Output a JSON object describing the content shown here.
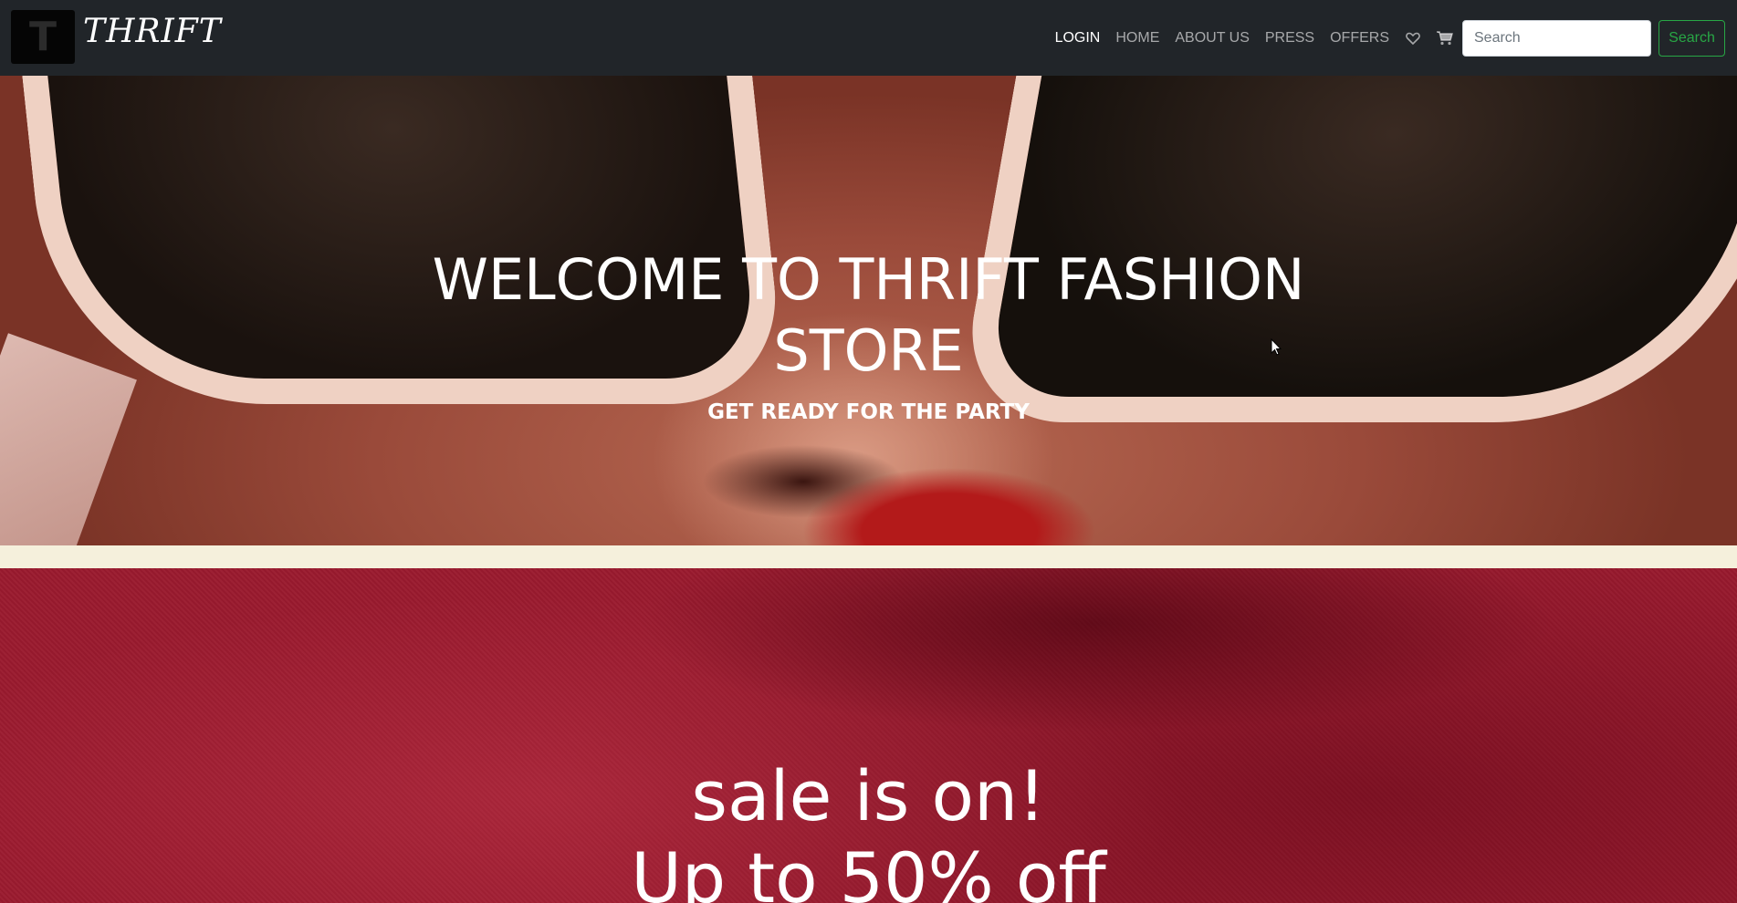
{
  "navbar": {
    "logo_letter": "T",
    "brand": "THRIFT",
    "links": [
      {
        "label": "LOGIN"
      },
      {
        "label": "HOME"
      },
      {
        "label": "ABOUT US"
      },
      {
        "label": "PRESS"
      },
      {
        "label": "OFFERS"
      }
    ],
    "icons": [
      "heart-icon",
      "cart-icon"
    ],
    "search_placeholder": "Search",
    "search_button": "Search"
  },
  "hero": {
    "title": "WELCOME TO THRIFT FASHION STORE",
    "subtitle": "GET READY FOR THE PARTY"
  },
  "sale": {
    "line1": "sale is on!",
    "line2": "Up to 50% off"
  },
  "colors": {
    "navbar_bg": "#212529",
    "search_accent": "#28a745",
    "strip": "#f5f0dc",
    "sale_bg": "#9a1a2e"
  }
}
